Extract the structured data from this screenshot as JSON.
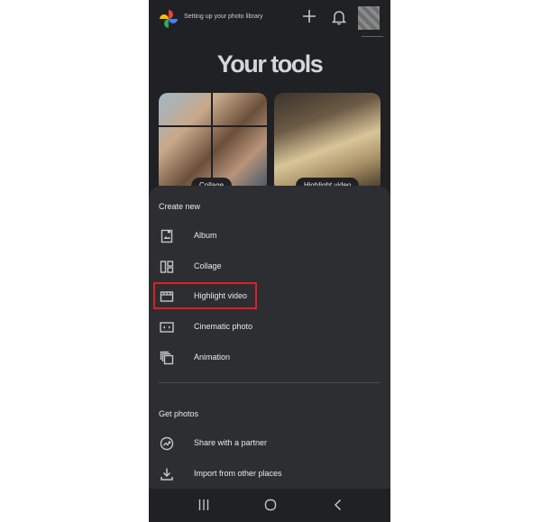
{
  "header": {
    "status_text": "Setting up your photo library",
    "icons": [
      "google-photos-logo",
      "plus-icon",
      "bell-icon",
      "avatar"
    ]
  },
  "tools": {
    "heading": "Your tools",
    "cards": [
      {
        "label": "Collage"
      },
      {
        "label": "Highlight video"
      }
    ]
  },
  "create_new": {
    "title": "Create new",
    "items": [
      {
        "label": "Album",
        "icon": "album-icon"
      },
      {
        "label": "Collage",
        "icon": "collage-icon"
      },
      {
        "label": "Highlight video",
        "icon": "highlight-video-icon",
        "highlighted": true
      },
      {
        "label": "Cinematic photo",
        "icon": "cinematic-photo-icon"
      },
      {
        "label": "Animation",
        "icon": "animation-icon"
      }
    ]
  },
  "get_photos": {
    "title": "Get photos",
    "items": [
      {
        "label": "Share with a partner",
        "icon": "partner-share-icon"
      },
      {
        "label": "Import from other places",
        "icon": "import-icon"
      }
    ]
  },
  "navbar": {
    "icons": [
      "recent-apps-icon",
      "home-icon",
      "back-icon"
    ]
  },
  "colors": {
    "background": "#202124",
    "sheet": "#2d2e31",
    "text": "#e8eaed",
    "highlight_border": "#e01e24"
  }
}
